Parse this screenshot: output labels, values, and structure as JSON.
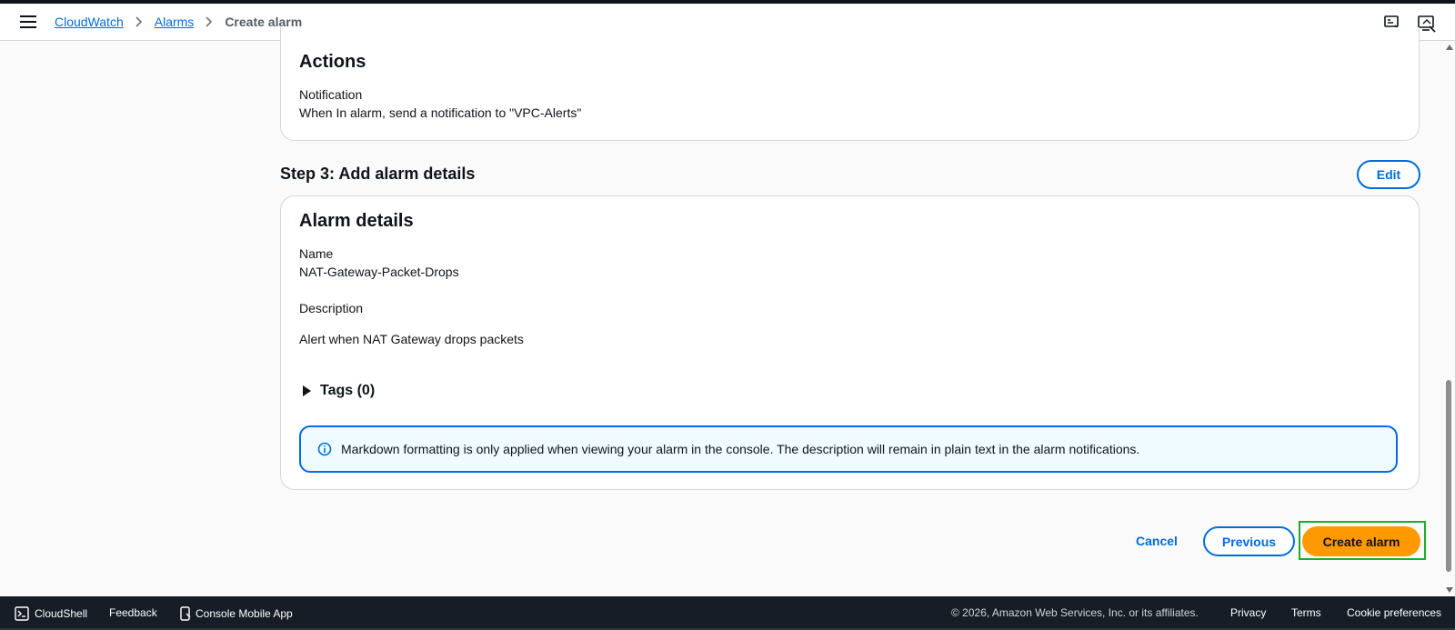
{
  "header": {
    "breadcrumb": {
      "root": "CloudWatch",
      "section": "Alarms",
      "current": "Create alarm"
    }
  },
  "actions": {
    "heading": "Actions",
    "notification_label": "Notification",
    "notification_value": "When In alarm, send a notification to \"VPC-Alerts\""
  },
  "step3": {
    "title": "Step 3: Add alarm details",
    "edit_label": "Edit"
  },
  "alarm_details": {
    "heading": "Alarm details",
    "name_label": "Name",
    "name_value": "NAT-Gateway-Packet-Drops",
    "description_label": "Description",
    "description_value": "Alert when NAT Gateway drops packets",
    "tags_label": "Tags (0)",
    "info_message": "Markdown formatting is only applied when viewing your alarm in the console. The description will remain in plain text in the alarm notifications."
  },
  "wizard_actions": {
    "cancel": "Cancel",
    "previous": "Previous",
    "create": "Create alarm"
  },
  "footer": {
    "cloudshell": "CloudShell",
    "feedback": "Feedback",
    "mobile_app": "Console Mobile App",
    "copyright": "© 2026, Amazon Web Services, Inc. or its affiliates.",
    "privacy": "Privacy",
    "terms": "Terms",
    "cookie": "Cookie preferences"
  },
  "colors": {
    "primary_blue": "#006ce0",
    "create_orange": "#ff9900",
    "highlight_green": "#1cad2b",
    "footer_bg": "#161d26"
  }
}
